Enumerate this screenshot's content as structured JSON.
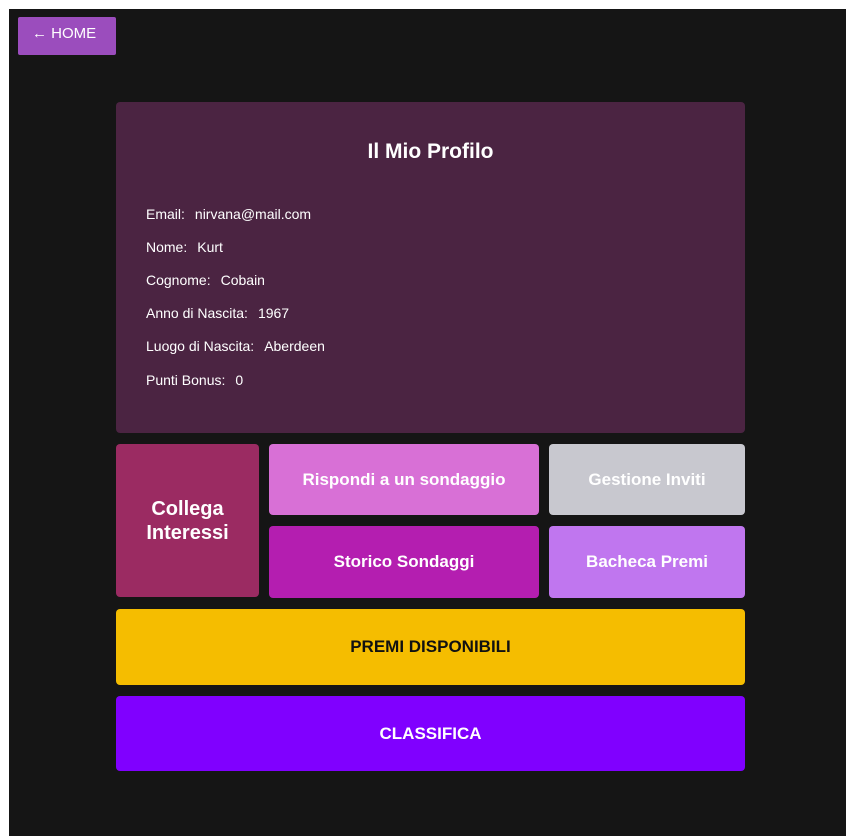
{
  "nav": {
    "home_label": "← HOME"
  },
  "profile": {
    "title": "Il Mio Profilo",
    "fields": [
      {
        "label": "Email:",
        "value": "nirvana@mail.com"
      },
      {
        "label": "Nome:",
        "value": "Kurt"
      },
      {
        "label": "Cognome:",
        "value": "Cobain"
      },
      {
        "label": "Anno di Nascita:",
        "value": "1967"
      },
      {
        "label": "Luogo di Nascita:",
        "value": "Aberdeen"
      },
      {
        "label": "Punti Bonus:",
        "value": "0"
      }
    ]
  },
  "actions": {
    "collega_line1": "Collega",
    "collega_line2": "Interessi",
    "rispondi": "Rispondi a un sondaggio",
    "gestione": "Gestione Inviti",
    "storico": "Storico Sondaggi",
    "bacheca": "Bacheca Premi",
    "premi": "PREMI DISPONIBILI",
    "classifica": "CLASSIFICA"
  },
  "colors": {
    "background": "#151515",
    "home_button": "#9b4dbd",
    "profile_card": "#4b2442",
    "collega": "#9b2b62",
    "rispondi": "#d870d6",
    "gestione": "#c8c8cf",
    "storico": "#b41eb0",
    "bacheca": "#c076ef",
    "premi": "#f5bd00",
    "classifica": "#8000ff"
  }
}
